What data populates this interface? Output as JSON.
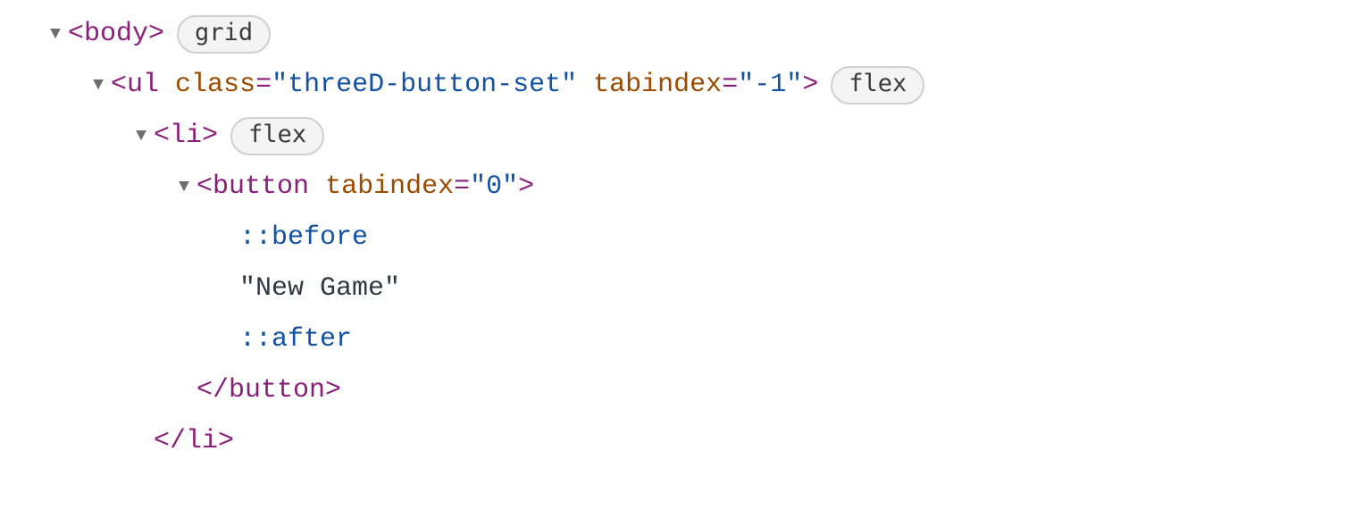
{
  "tree": {
    "row0": {
      "open": "<",
      "tag": "body",
      "close": ">",
      "badge": "grid"
    },
    "row1": {
      "open": "<",
      "tag": "ul",
      "attr1_name": "class",
      "eq": "=",
      "attr1_val": "\"threeD-button-set\"",
      "attr2_name": "tabindex",
      "attr2_val": "\"-1\"",
      "close": ">",
      "badge": "flex"
    },
    "row2": {
      "open": "<",
      "tag": "li",
      "close": ">",
      "badge": "flex"
    },
    "row3": {
      "open": "<",
      "tag": "button",
      "attr1_name": "tabindex",
      "eq": "=",
      "attr1_val": "\"0\"",
      "close": ">"
    },
    "row4": {
      "pseudo": "::before"
    },
    "row5": {
      "text": "\"New Game\""
    },
    "row6": {
      "pseudo": "::after"
    },
    "row7": {
      "open": "</",
      "tag": "button",
      "close": ">"
    },
    "row8": {
      "open": "</",
      "tag": "li",
      "close": ">"
    }
  }
}
